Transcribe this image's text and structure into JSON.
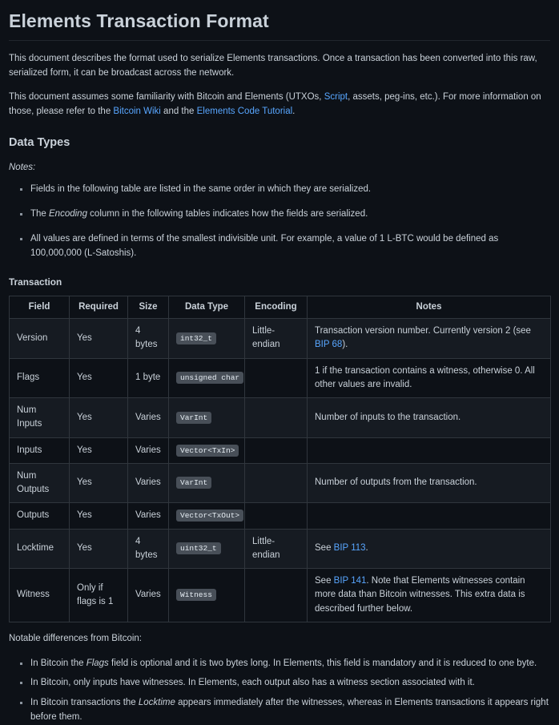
{
  "document": {
    "title": "Elements Transaction Format",
    "intro_paragraph_1": "This document describes the format used to serialize Elements transactions. Once a transaction has been converted into this raw, serialized form, it can be broadcast across the network.",
    "intro_paragraph_2": {
      "part1": "This document assumes some familiarity with Bitcoin and Elements (UTXOs, ",
      "link1": "Script",
      "part2": ", assets, peg-ins, etc.). For more information on those, please refer to the ",
      "link2": "Bitcoin Wiki",
      "part3": " and the ",
      "link3": "Elements Code Tutorial",
      "part4": "."
    }
  },
  "data_types": {
    "heading": "Data Types",
    "notes_label": "Notes:",
    "notes": [
      {
        "part1": "Fields in the following table are listed in the same order in which they are serialized.",
        "em": "",
        "part2": ""
      },
      {
        "part1": "The ",
        "em": "Encoding",
        "part2": " column in the following tables indicates how the fields are serialized."
      },
      {
        "part1": "All values are defined in terms of the smallest indivisible unit. For example, a value of 1 L-BTC would be defined as 100,000,000 (L-Satoshis).",
        "em": "",
        "part2": ""
      }
    ]
  },
  "transaction": {
    "heading": "Transaction",
    "table": {
      "headers": [
        "Field",
        "Required",
        "Size",
        "Data Type",
        "Encoding",
        "Notes"
      ],
      "rows": [
        {
          "field": "Version",
          "required": "Yes",
          "size": "4 bytes",
          "data_type": "int32_t",
          "encoding": "Little-endian",
          "notes_pre": "Transaction version number. Currently version 2 (see ",
          "notes_link": "BIP 68",
          "notes_post": ")."
        },
        {
          "field": "Flags",
          "required": "Yes",
          "size": "1 byte",
          "data_type": "unsigned char",
          "encoding": "",
          "notes_pre": "1 if the transaction contains a witness, otherwise 0. All other values are invalid.",
          "notes_link": "",
          "notes_post": ""
        },
        {
          "field": "Num Inputs",
          "required": "Yes",
          "size": "Varies",
          "data_type": "VarInt",
          "encoding": "",
          "notes_pre": "Number of inputs to the transaction.",
          "notes_link": "",
          "notes_post": ""
        },
        {
          "field": "Inputs",
          "required": "Yes",
          "size": "Varies",
          "data_type": "Vector<TxIn>",
          "encoding": "",
          "notes_pre": "",
          "notes_link": "",
          "notes_post": ""
        },
        {
          "field": "Num Outputs",
          "required": "Yes",
          "size": "Varies",
          "data_type": "VarInt",
          "encoding": "",
          "notes_pre": "Number of outputs from the transaction.",
          "notes_link": "",
          "notes_post": ""
        },
        {
          "field": "Outputs",
          "required": "Yes",
          "size": "Varies",
          "data_type": "Vector<TxOut>",
          "encoding": "",
          "notes_pre": "",
          "notes_link": "",
          "notes_post": ""
        },
        {
          "field": "Locktime",
          "required": "Yes",
          "size": "4 bytes",
          "data_type": "uint32_t",
          "encoding": "Little-endian",
          "notes_pre": "See ",
          "notes_link": "BIP 113",
          "notes_post": "."
        },
        {
          "field": "Witness",
          "required": "Only if flags is 1",
          "size": "Varies",
          "data_type": "Witness",
          "encoding": "",
          "notes_pre": "See ",
          "notes_link": "BIP 141",
          "notes_post": ". Note that Elements witnesses contain more data than Bitcoin witnesses. This extra data is described further below."
        }
      ]
    }
  },
  "differences": {
    "intro": "Notable differences from Bitcoin:",
    "items": [
      {
        "part1": "In Bitcoin the ",
        "em": "Flags",
        "part2": " field is optional and it is two bytes long. In Elements, this field is mandatory and it is reduced to one byte."
      },
      {
        "part1": "In Bitcoin, only inputs have witnesses. In Elements, each output also has a witness section associated with it.",
        "em": "",
        "part2": ""
      },
      {
        "part1": "In Bitcoin transactions the ",
        "em": "Locktime",
        "part2": " appears immediately after the witnesses, whereas in Elements transactions it appears right before them."
      }
    ]
  },
  "theme": {
    "background": "#0d1117",
    "text": "#c9d1d9",
    "link": "#58a6ff",
    "border": "#30363d",
    "row_alt": "#161b22",
    "code_bg": "#484f58"
  }
}
